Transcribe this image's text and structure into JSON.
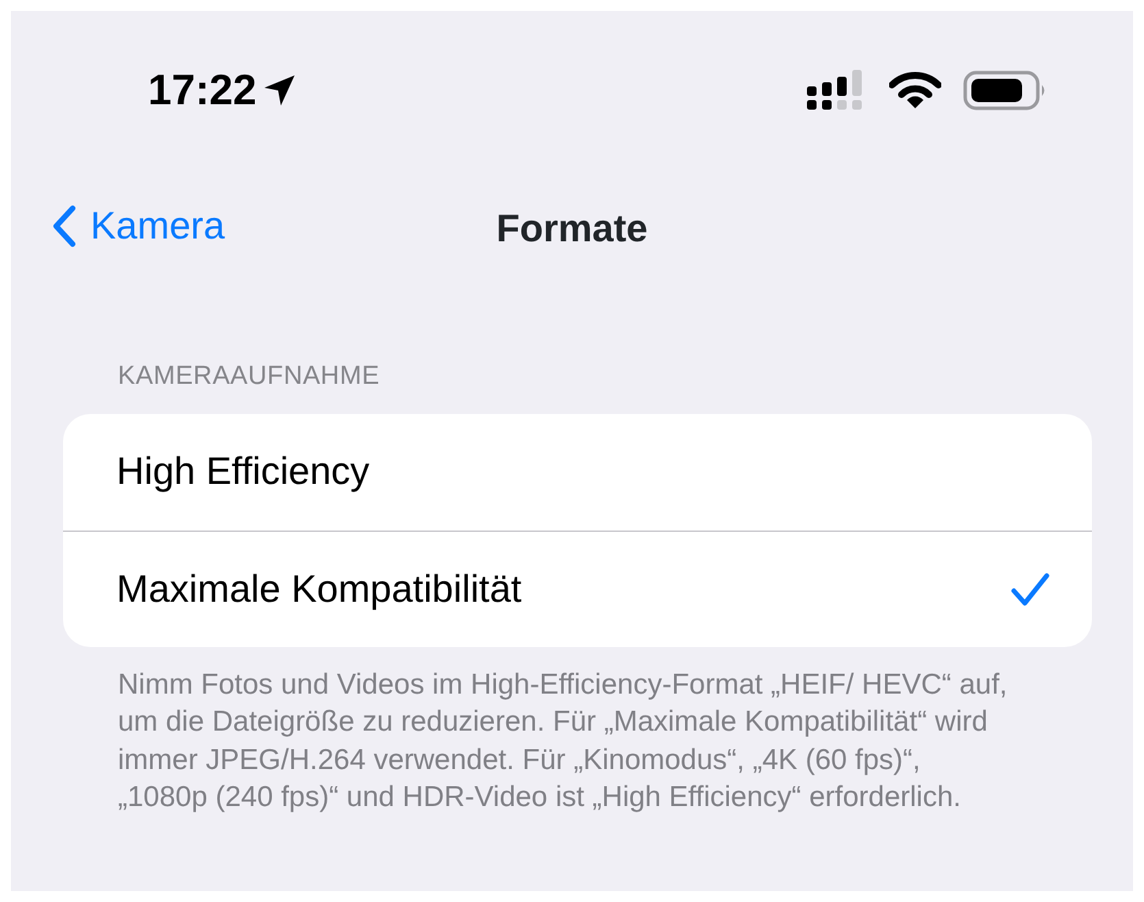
{
  "status_bar": {
    "time": "17:22"
  },
  "nav": {
    "back": "Kamera",
    "title": "Formate"
  },
  "section": {
    "header": "KAMERAAUFNAHME",
    "options": [
      {
        "label": "High Efficiency",
        "selected": false
      },
      {
        "label": "Maximale Kompatibilität",
        "selected": true
      }
    ],
    "footer": "Nimm Fotos und Videos im High-Efficiency-Format „HEIF/ HEVC“ auf, um die Dateigröße zu reduzieren. Für „Maximale Kompatibilität“ wird immer JPEG/H.264 verwendet. Für „Kinomodus“, „4K (60 fps)“, „1080p (240 fps)“ und HDR-Video ist „High Efficiency“ erforderlich."
  }
}
